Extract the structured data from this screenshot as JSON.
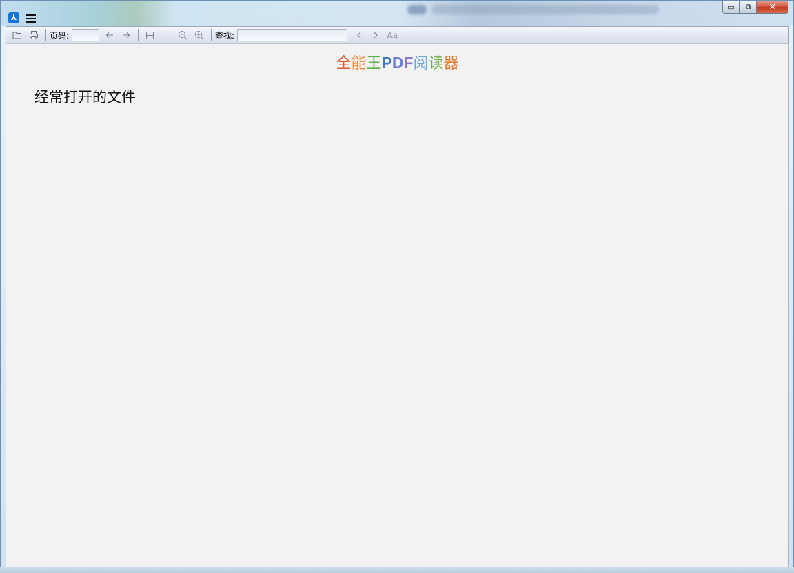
{
  "window": {
    "controls": {
      "minimize": "▭",
      "restore": "⧉",
      "close": "✕"
    }
  },
  "toolbar": {
    "page_label": "页码:",
    "page_value": "",
    "search_label": "查找:",
    "search_value": "",
    "match_case_label": "Aa",
    "icons": [
      "folder-open-icon",
      "print-icon",
      "arrow-left-icon",
      "arrow-right-icon",
      "fit-width-icon",
      "fit-page-icon",
      "zoom-out-icon",
      "zoom-in-icon",
      "chevron-left-icon",
      "chevron-right-icon"
    ]
  },
  "brand": {
    "segments": [
      {
        "text": "全",
        "color": "#e0572e"
      },
      {
        "text": "能",
        "color": "#f08c3a"
      },
      {
        "text": "王",
        "color": "#5fb14a"
      },
      {
        "text": "P",
        "color": "#3d7bc4"
      },
      {
        "text": "D",
        "color": "#6a7fd0"
      },
      {
        "text": "F",
        "color": "#8a78c8"
      },
      {
        "text": "阅",
        "color": "#6fa6d8"
      },
      {
        "text": "读",
        "color": "#6cae44"
      },
      {
        "text": "器",
        "color": "#e07a2e"
      }
    ]
  },
  "content": {
    "recent_files_heading": "经常打开的文件"
  }
}
